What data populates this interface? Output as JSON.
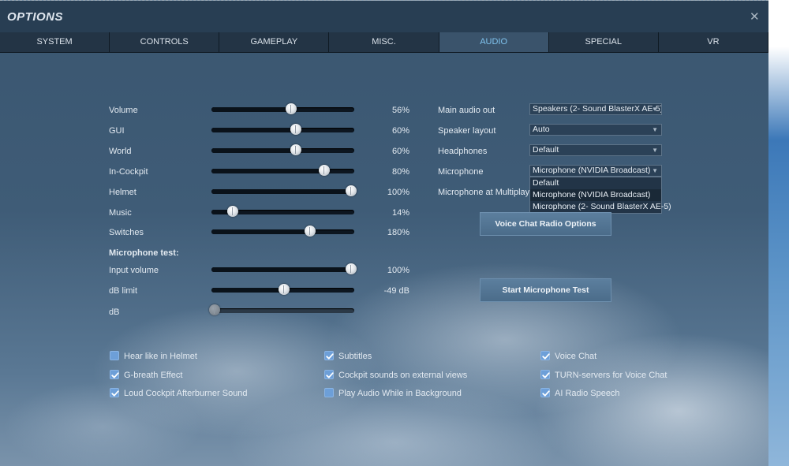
{
  "window": {
    "title": "OPTIONS",
    "close_glyph": "✕"
  },
  "tabs": [
    {
      "label": "SYSTEM"
    },
    {
      "label": "CONTROLS"
    },
    {
      "label": "GAMEPLAY"
    },
    {
      "label": "MISC."
    },
    {
      "label": "AUDIO"
    },
    {
      "label": "SPECIAL"
    },
    {
      "label": "VR"
    }
  ],
  "active_tab": "AUDIO",
  "sliders": [
    {
      "label": "Volume",
      "value_text": "56%",
      "fraction": 0.56
    },
    {
      "label": "GUI",
      "value_text": "60%",
      "fraction": 0.59
    },
    {
      "label": "World",
      "value_text": "60%",
      "fraction": 0.59
    },
    {
      "label": "In-Cockpit",
      "value_text": "80%",
      "fraction": 0.79
    },
    {
      "label": "Helmet",
      "value_text": "100%",
      "fraction": 0.98
    },
    {
      "label": "Music",
      "value_text": "14%",
      "fraction": 0.15
    },
    {
      "label": "Switches",
      "value_text": "180%",
      "fraction": 0.69
    }
  ],
  "mic_test": {
    "heading": "Microphone test:",
    "input_volume": {
      "label": "Input volume",
      "value_text": "100%",
      "fraction": 0.98
    },
    "db_limit": {
      "label": "dB limit",
      "value_text": "-49 dB",
      "fraction": 0.51
    },
    "db": {
      "label": "dB",
      "fraction": 0.02
    }
  },
  "devices": {
    "main_audio_out": {
      "label": "Main audio out",
      "value": "Speakers (2- Sound BlasterX AE-5)"
    },
    "speaker_layout": {
      "label": "Speaker layout",
      "value": "Auto"
    },
    "headphones": {
      "label": "Headphones",
      "value": "Default"
    },
    "microphone": {
      "label": "Microphone",
      "value": "Microphone (NVIDIA Broadcast)"
    },
    "microphone_multiplayer": {
      "label": "Microphone at Multiplayer"
    },
    "mic_options": [
      "Default",
      "Microphone (NVIDIA Broadcast)",
      "Microphone (2- Sound BlasterX AE-5)"
    ]
  },
  "buttons": {
    "voice_chat_radio_options": "Voice Chat Radio Options",
    "start_mic_test": "Start Microphone Test"
  },
  "checkboxes": [
    {
      "label": "Hear like in Helmet",
      "checked": false
    },
    {
      "label": "G-breath Effect",
      "checked": true
    },
    {
      "label": "Loud Cockpit Afterburner Sound",
      "checked": true
    },
    {
      "label": "Subtitles",
      "checked": true
    },
    {
      "label": "Cockpit sounds on external views",
      "checked": true
    },
    {
      "label": "Play Audio While in Background",
      "checked": false
    },
    {
      "label": "Voice Chat",
      "checked": true
    },
    {
      "label": "TURN-servers for Voice Chat",
      "checked": true
    },
    {
      "label": "AI Radio Speech",
      "checked": true
    }
  ],
  "colors": {
    "accent": "#7fc3ee",
    "checkbox": "#6d9fd8"
  }
}
